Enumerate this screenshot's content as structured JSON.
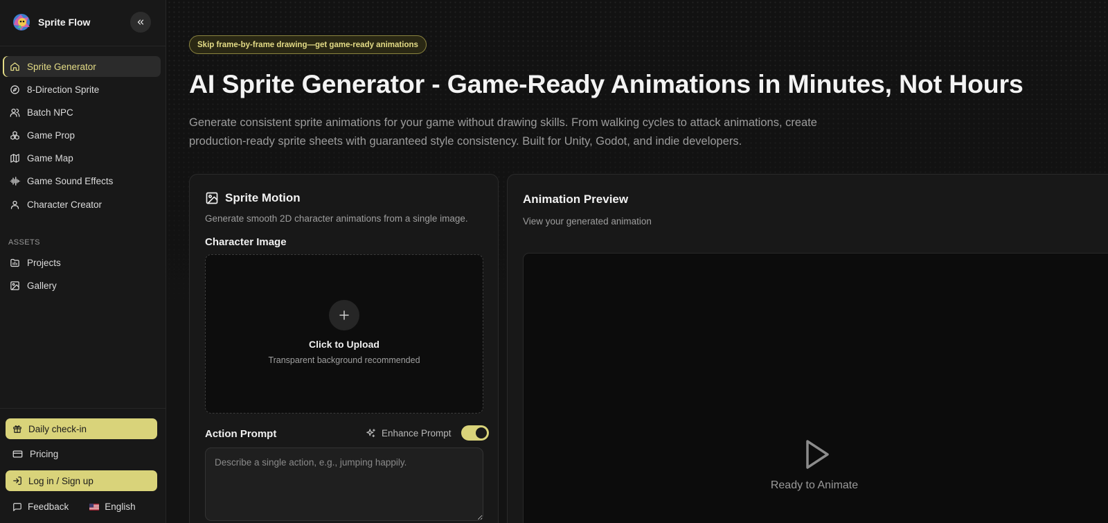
{
  "app": {
    "name": "Sprite Flow",
    "logo_icon": "sprite-flow-logo"
  },
  "sidebar": {
    "collapse_icon": "chevrons-left-icon",
    "nav_items": [
      {
        "label": "Sprite Generator",
        "icon": "home-icon",
        "active": true
      },
      {
        "label": "8-Direction Sprite",
        "icon": "compass-icon",
        "active": false
      },
      {
        "label": "Batch NPC",
        "icon": "users-icon",
        "active": false
      },
      {
        "label": "Game Prop",
        "icon": "boxes-icon",
        "active": false
      },
      {
        "label": "Game Map",
        "icon": "map-icon",
        "active": false
      },
      {
        "label": "Game Sound Effects",
        "icon": "audio-waveform-icon",
        "active": false
      },
      {
        "label": "Character Creator",
        "icon": "user-icon",
        "active": false
      }
    ],
    "assets_label": "ASSETS",
    "assets_items": [
      {
        "label": "Projects",
        "icon": "folder-icon"
      },
      {
        "label": "Gallery",
        "icon": "image-icon"
      }
    ],
    "daily_checkin_label": "Daily check-in",
    "pricing_label": "Pricing",
    "login_label": "Log in / Sign up",
    "feedback_label": "Feedback",
    "language_label": "English"
  },
  "hero": {
    "badge": "Skip frame-by-frame drawing—get game-ready animations",
    "title": "AI Sprite Generator - Game-Ready Animations in Minutes, Not Hours",
    "subtitle": "Generate consistent sprite animations for your game without drawing skills. From walking cycles to attack animations, create production-ready sprite sheets with guaranteed style consistency. Built for Unity, Godot, and indie developers."
  },
  "sprite_motion": {
    "title": "Sprite Motion",
    "subtitle": "Generate smooth 2D character animations from a single image.",
    "character_image_label": "Character Image",
    "upload_title": "Click to Upload",
    "upload_hint": "Transparent background recommended",
    "action_prompt_label": "Action Prompt",
    "enhance_prompt_label": "Enhance Prompt",
    "enhance_prompt_enabled": true,
    "prompt_value": "",
    "prompt_placeholder": "Describe a single action, e.g., jumping happily."
  },
  "preview": {
    "title": "Animation Preview",
    "subtitle": "View your generated animation",
    "status": "Ready to Animate"
  },
  "colors": {
    "accent": "#d9d37a",
    "accent_text": "#e4dc86",
    "background": "#141414",
    "card": "#181818"
  }
}
